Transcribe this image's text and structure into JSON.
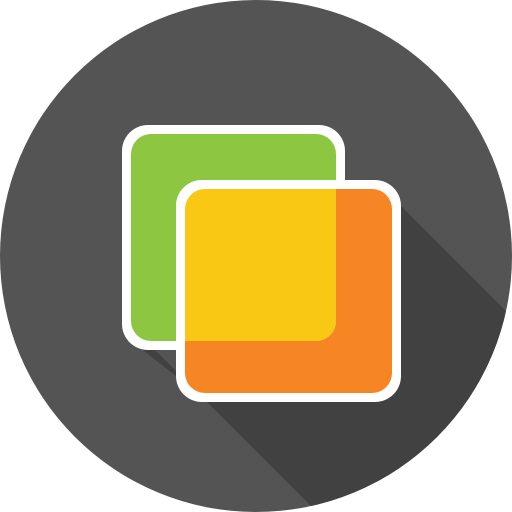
{
  "icon": {
    "name": "overlapping-squares-icon",
    "colors": {
      "background": "#555455",
      "long_shadow": "#424142",
      "outline": "#ffffff",
      "back_square": "#8dc641",
      "front_square": "#f68623",
      "overlap": "#f8c814"
    }
  }
}
